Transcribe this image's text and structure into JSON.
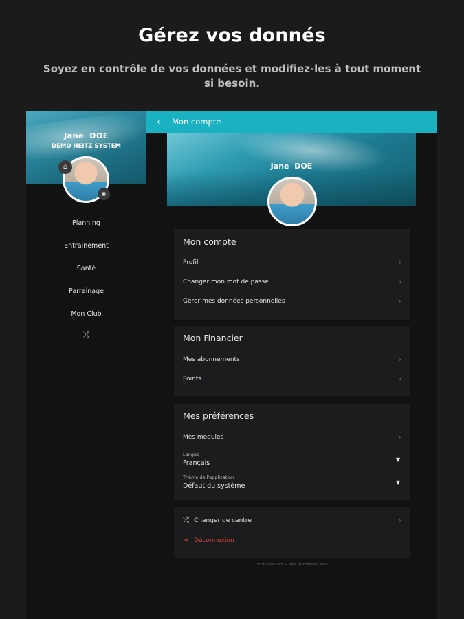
{
  "hero": {
    "title": "Gérez vos donnés",
    "subtitle": "Soyez en contrôle de vos données et modifiez-les à tout moment si besoin."
  },
  "sidebar": {
    "user_name": "Jane  DOE",
    "org": "DEMO HEITZ SYSTEM",
    "items": [
      {
        "label": "Planning"
      },
      {
        "label": "Entrainement"
      },
      {
        "label": "Santé"
      },
      {
        "label": "Parrainage"
      },
      {
        "label": "Mon Club"
      }
    ],
    "switch_icon": "shuffle-icon",
    "home_icon": "home-icon",
    "camera_icon": "camera-icon"
  },
  "appbar": {
    "title": "Mon compte",
    "color": "#1ab1c3"
  },
  "profile": {
    "name": "Jane  DOE"
  },
  "sections": {
    "account": {
      "title": "Mon compte",
      "items": [
        "Profil",
        "Changer mon mot de passe",
        "Gérer mes données personnelles"
      ]
    },
    "financial": {
      "title": "Mon Financier",
      "items": [
        "Mes abonnements",
        "Points"
      ]
    },
    "preferences": {
      "title": "Mes préférences",
      "modules": "Mes modules",
      "language_label": "Langue",
      "language_value": "Français",
      "theme_label": "Thème de l'application",
      "theme_value": "Défaut du système"
    },
    "actions": {
      "change_center": "Changer de centre",
      "logout": "Déconnexion",
      "logout_color": "#d9453a"
    }
  },
  "footer": {
    "text": "Id 3000000765  —  Type de compte Client"
  }
}
